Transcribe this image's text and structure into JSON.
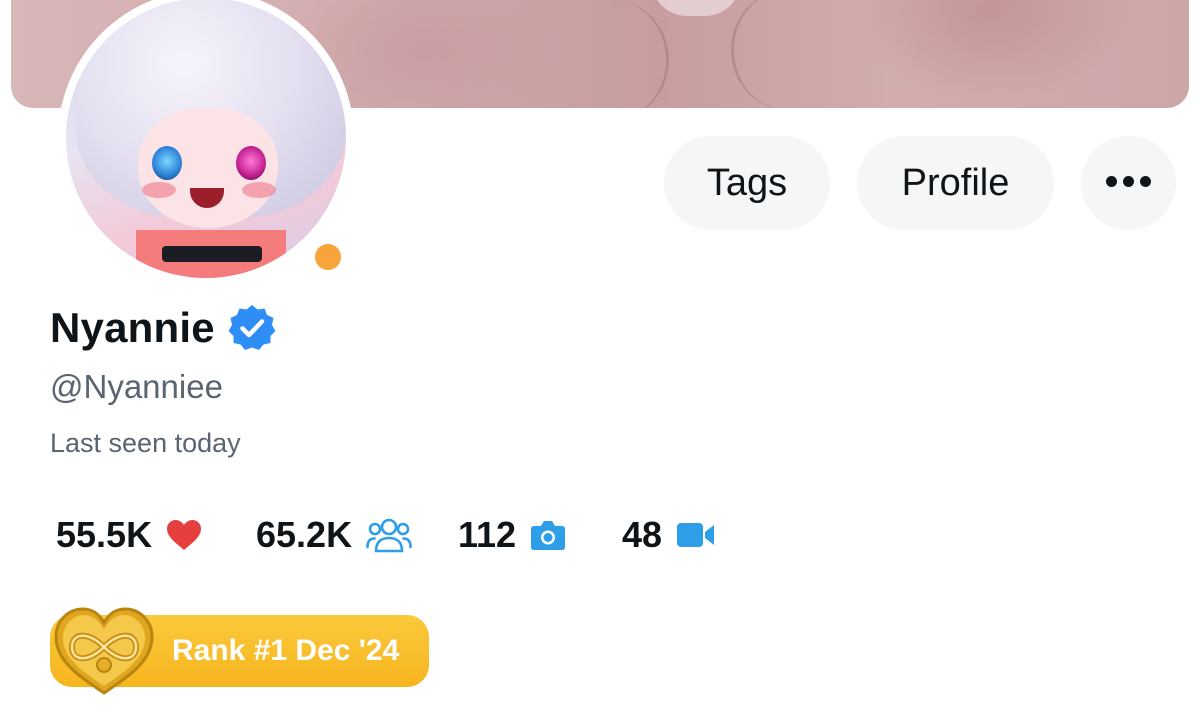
{
  "header": {
    "actions": {
      "tags_label": "Tags",
      "profile_label": "Profile",
      "more_icon": "more-horizontal-icon"
    }
  },
  "profile": {
    "display_name": "Nyannie",
    "handle": "@Nyanniee",
    "last_seen": "Last seen today",
    "verified": true,
    "online_status_color": "#f7a53b"
  },
  "stats": [
    {
      "value": "55.5K",
      "icon": "heart-icon",
      "color": "#e5403f"
    },
    {
      "value": "65.2K",
      "icon": "fans-icon",
      "color": "#2f9ee8"
    },
    {
      "value": "112",
      "icon": "camera-icon",
      "color": "#2f9ee8"
    },
    {
      "value": "48",
      "icon": "video-icon",
      "color": "#2f9ee8"
    }
  ],
  "rank_badge": {
    "label": "Rank #1 Dec '24",
    "icon": "infinity-heart-icon",
    "color": "#f8bd28"
  },
  "colors": {
    "accent": "#2f9ee8",
    "verified": "#2f8ef5",
    "button_bg": "#f5f6f8"
  }
}
